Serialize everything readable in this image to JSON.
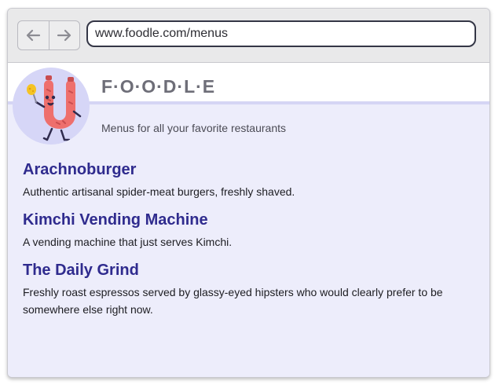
{
  "browser": {
    "back_icon": "arrow-left-icon",
    "forward_icon": "arrow-right-icon",
    "url": "www.foodle.com/menus"
  },
  "site": {
    "logo_icon": "sausage-mascot-icon",
    "title": "F·O·O·D·L·E",
    "tagline": "Menus for all your favorite restaurants"
  },
  "restaurants": [
    {
      "name": "Arachnoburger",
      "description": "Authentic artisanal spider-meat burgers, freshly shaved."
    },
    {
      "name": "Kimchi Vending Machine",
      "description": "A vending machine that just serves Kimchi."
    },
    {
      "name": "The Daily Grind",
      "description": "Freshly roast espressos served by glassy-eyed hipsters who would clearly prefer to be somewhere else right now."
    }
  ],
  "colors": {
    "accent": "#2f2b8e",
    "page_bg": "#ededfb",
    "logo_bg": "#d6d6f7"
  }
}
